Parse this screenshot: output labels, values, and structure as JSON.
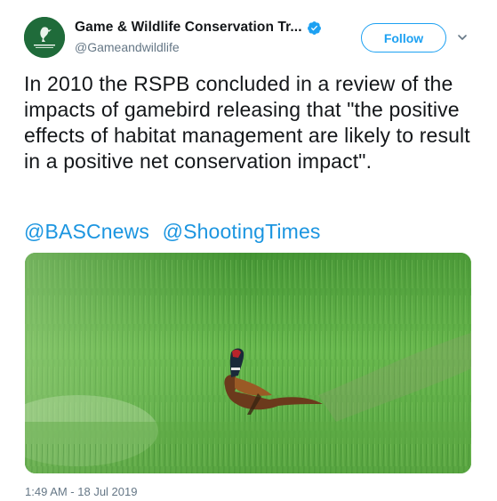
{
  "account": {
    "display_name": "Game & Wildlife Conservation Tr...",
    "handle": "@Gameandwildlife",
    "verified": true,
    "avatar_icon": "gwct-logo-icon"
  },
  "actions": {
    "follow_label": "Follow",
    "menu_icon": "chevron-down-icon"
  },
  "tweet": {
    "text": "In 2010 the RSPB concluded in a review of the impacts of gamebird releasing that \"the positive effects of habitat management are likely to result in a positive net conservation impact\".",
    "mentions": [
      "@BASCnews",
      "@ShootingTimes"
    ],
    "timestamp": "1:49 AM - 18 Jul 2019"
  },
  "media": {
    "type": "photo",
    "subject": "pheasant in green grass field"
  },
  "colors": {
    "accent": "#1da1f2",
    "link": "#1b95e0",
    "muted": "#657786",
    "avatar_bg": "#1f6b3a"
  }
}
